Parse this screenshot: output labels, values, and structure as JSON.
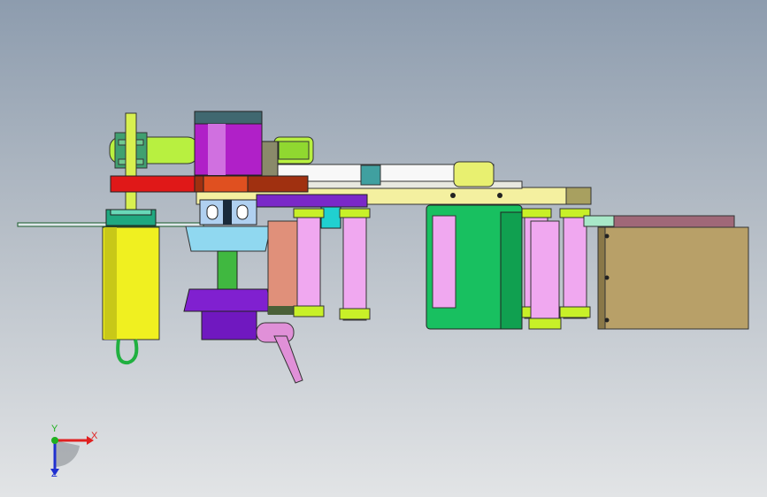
{
  "viewport": {
    "background": [
      "#8d9cae",
      "#e2e4e6"
    ]
  },
  "triad": {
    "x_label": "X",
    "y_label": "Y",
    "z_label": "Z",
    "x_color": "#e02020",
    "y_color": "#20b020",
    "z_color": "#2030d0"
  },
  "part_colors": {
    "plate": "#f4f0a0",
    "belt": "#f8f8f8",
    "roller": "#f0a8f0",
    "roller_ring": "#c8f028",
    "spindle_sleeve": "#b020c8",
    "red_bar": "#e01818",
    "brown_bar": "#a03010",
    "cylinder": "#f0f020",
    "green_block": "#18c060",
    "cup": "#90d8f0",
    "wheel": "#8020d0",
    "handle": "#e090d8",
    "motor_box": "#b8a068",
    "salmon_block": "#e0907a"
  },
  "icons": [
    "coordinate-triad-icon"
  ]
}
